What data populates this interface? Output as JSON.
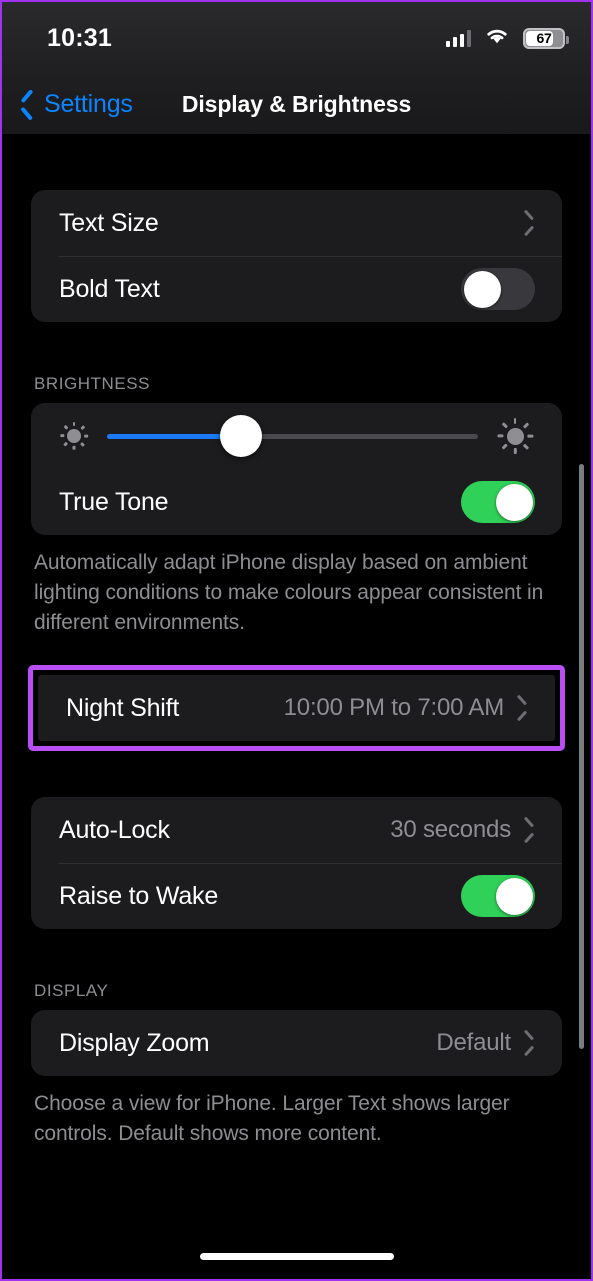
{
  "status_bar": {
    "time": "10:31",
    "signal_icon": "cellular-bars-icon",
    "wifi_icon": "wifi-icon",
    "battery_percent": "67",
    "battery_icon": "battery-icon"
  },
  "nav": {
    "back_label": "Settings",
    "back_icon": "chevron-left-icon",
    "title": "Display & Brightness"
  },
  "sections": {
    "text": {
      "rows": [
        {
          "label": "Text Size",
          "value": "",
          "accessory": "chevron-right-icon"
        },
        {
          "label": "Bold Text",
          "value": "",
          "accessory": "toggle-off"
        }
      ]
    },
    "brightness": {
      "header": "BRIGHTNESS",
      "slider": {
        "name": "brightness-slider",
        "value_percent": "36",
        "min_icon": "sun-small-icon",
        "max_icon": "sun-large-icon",
        "fill_color": "#1a7af5"
      },
      "true_tone": {
        "label": "True Tone",
        "accessory": "toggle-on"
      },
      "footer": "Automatically adapt iPhone display based on ambient lighting conditions to make colours appear consistent in different environments."
    },
    "night_shift": {
      "label": "Night Shift",
      "value": "10:00 PM to 7:00 AM",
      "accessory": "chevron-right-icon",
      "highlight_color": "#b94ef5"
    },
    "lock": {
      "rows": [
        {
          "label": "Auto-Lock",
          "value": "30 seconds",
          "accessory": "chevron-right-icon"
        },
        {
          "label": "Raise to Wake",
          "value": "",
          "accessory": "toggle-on"
        }
      ]
    },
    "display": {
      "header": "DISPLAY",
      "rows": [
        {
          "label": "Display Zoom",
          "value": "Default",
          "accessory": "chevron-right-icon"
        }
      ],
      "footer": "Choose a view for iPhone. Larger Text shows larger controls. Default shows more content."
    }
  },
  "colors": {
    "accent_blue": "#0a84ff",
    "toggle_on_green": "#30d158",
    "card_bg": "#1c1c1e",
    "highlight_purple": "#b94ef5"
  }
}
